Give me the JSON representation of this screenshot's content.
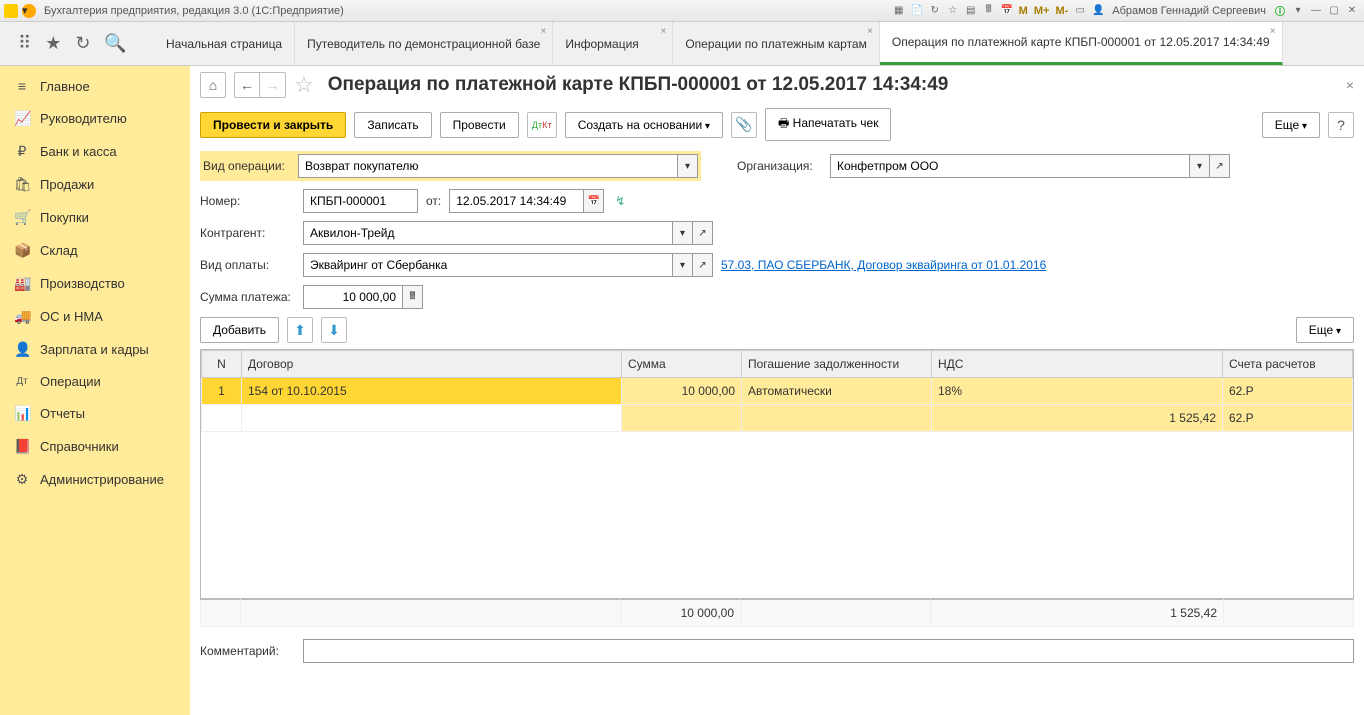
{
  "titlebar": {
    "title": "Бухгалтерия предприятия, редакция 3.0 (1С:Предприятие)",
    "user": "Абрамов Геннадий Сергеевич"
  },
  "tabs": [
    {
      "label": "Начальная страница"
    },
    {
      "label": "Путеводитель по демонстрационной базе"
    },
    {
      "label": "Информация"
    },
    {
      "label": "Операции по платежным картам"
    },
    {
      "label": "Операция по платежной карте КПБП-000001 от 12.05.2017 14:34:49",
      "active": true
    }
  ],
  "sidebar": [
    {
      "icon": "≡",
      "label": "Главное"
    },
    {
      "icon": "📈",
      "label": "Руководителю"
    },
    {
      "icon": "₽",
      "label": "Банк и касса"
    },
    {
      "icon": "🛍",
      "label": "Продажи"
    },
    {
      "icon": "🛒",
      "label": "Покупки"
    },
    {
      "icon": "📦",
      "label": "Склад"
    },
    {
      "icon": "🏭",
      "label": "Производство"
    },
    {
      "icon": "🚚",
      "label": "ОС и НМА"
    },
    {
      "icon": "👤",
      "label": "Зарплата и кадры"
    },
    {
      "icon": "Дт",
      "label": "Операции"
    },
    {
      "icon": "📊",
      "label": "Отчеты"
    },
    {
      "icon": "📕",
      "label": "Справочники"
    },
    {
      "icon": "⚙",
      "label": "Администрирование"
    }
  ],
  "page": {
    "title": "Операция по платежной карте КПБП-000001 от 12.05.2017 14:34:49",
    "toolbar": {
      "post_close": "Провести и закрыть",
      "save": "Записать",
      "post": "Провести",
      "create_based": "Создать на основании",
      "print_check": "Напечатать чек",
      "more": "Еще"
    },
    "labels": {
      "op_type": "Вид операции:",
      "number": "Номер:",
      "from": "от:",
      "org": "Организация:",
      "contractor": "Контрагент:",
      "pay_type": "Вид оплаты:",
      "amount": "Сумма платежа:",
      "add": "Добавить",
      "comment": "Комментарий:"
    },
    "values": {
      "op_type": "Возврат покупателю",
      "number": "КПБП-000001",
      "date": "12.05.2017 14:34:49",
      "org": "Конфетпром ООО",
      "contractor": "Аквилон-Трейд",
      "pay_type": "Эквайринг от Сбербанка",
      "pay_link": "57.03, ПАО СБЕРБАНК, Договор эквайринга от 01.01.2016",
      "amount": "10 000,00"
    },
    "table": {
      "headers": {
        "n": "N",
        "contract": "Договор",
        "sum": "Сумма",
        "repay": "Погашение задолженности",
        "vat": "НДС",
        "accounts": "Счета расчетов"
      },
      "rows": [
        {
          "n": "1",
          "contract": "154 от 10.10.2015",
          "sum": "10 000,00",
          "repay": "Автоматически",
          "vat": "18%",
          "account": "62.Р"
        },
        {
          "n": "",
          "contract": "",
          "sum": "",
          "repay": "",
          "vat": "1 525,42",
          "account": "62.Р"
        }
      ],
      "footer": {
        "sum": "10 000,00",
        "vat": "1 525,42"
      }
    }
  }
}
